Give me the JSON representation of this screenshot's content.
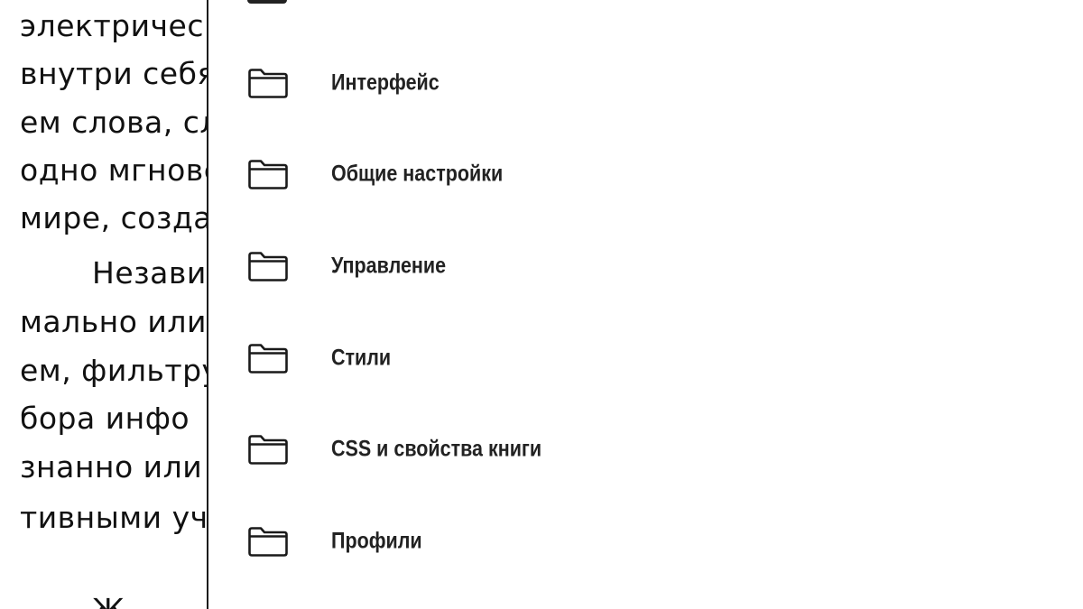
{
  "book": {
    "lines": [
      "электрическ",
      "внутри себя",
      "ем слова, сл",
      "одно мгнове",
      "мире, созда",
      "Незави",
      "мально или",
      "ем, фильтру",
      "бора инфо",
      "знанно или",
      "тивными уча",
      "",
      "Ж"
    ]
  },
  "menu": {
    "items": [
      {
        "label": "Интерфейс",
        "icon": "folder-icon"
      },
      {
        "label": "Общие настройки",
        "icon": "folder-icon"
      },
      {
        "label": "Управление",
        "icon": "folder-icon"
      },
      {
        "label": "Стили",
        "icon": "folder-icon"
      },
      {
        "label": "CSS и свойства книги",
        "icon": "folder-icon"
      },
      {
        "label": "Профили",
        "icon": "folder-icon"
      }
    ]
  }
}
